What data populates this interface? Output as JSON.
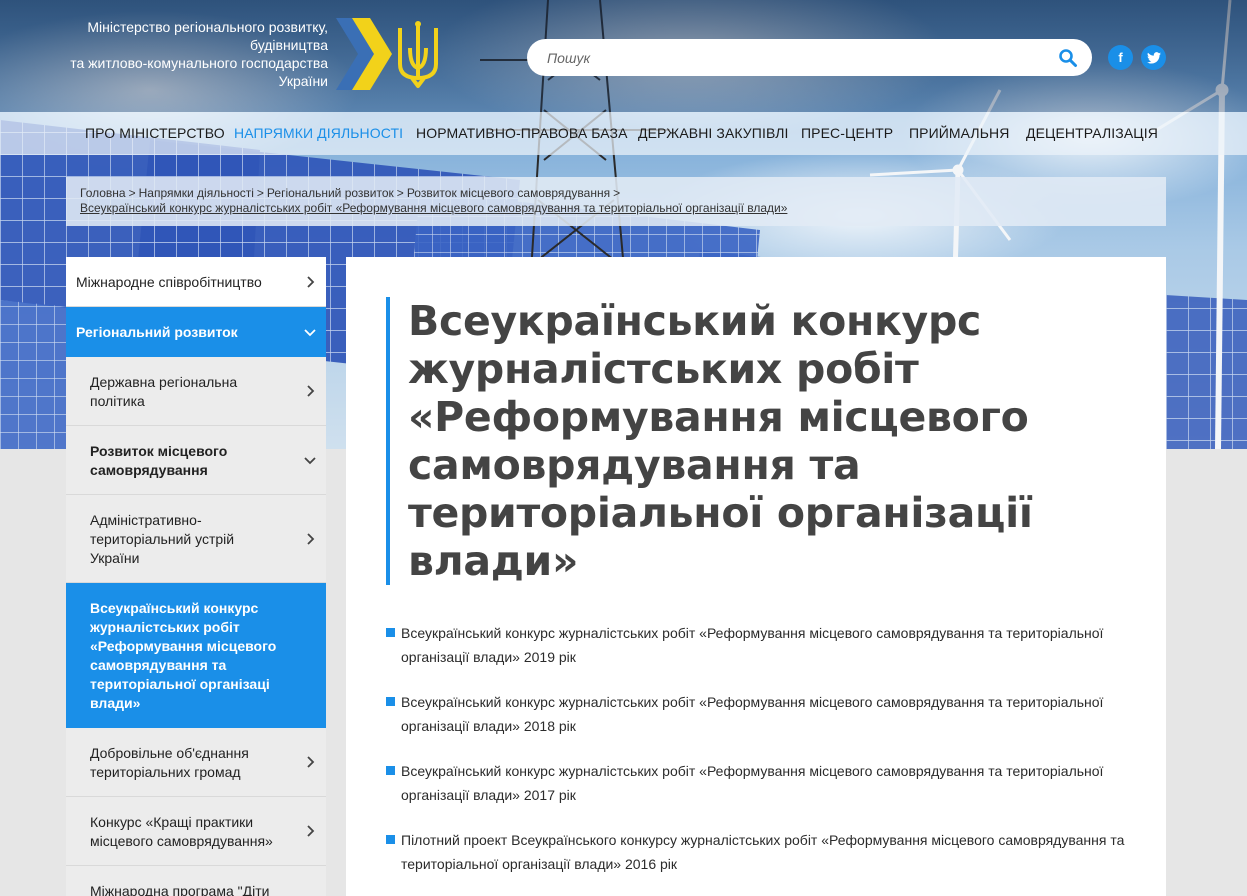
{
  "header": {
    "ministry_line1": "Міністерство регіонального розвитку,",
    "ministry_line2": "будівництва",
    "ministry_line3": "та житлово-комунального господарства",
    "ministry_line4": "України",
    "search_placeholder": "Пошук",
    "search_icon": "search-icon",
    "social_fb": "f",
    "social_tw": "twitter-icon"
  },
  "colors": {
    "accent": "#1a8fe8",
    "logo_blue": "#3a6fb5",
    "logo_yellow": "#f2d21a"
  },
  "nav": {
    "items": [
      "ПРО МІНІСТЕРСТВО",
      "НАПРЯМКИ ДІЯЛЬНОСТІ",
      "НОРМАТИВНО-ПРАВОВА БАЗА",
      "ДЕРЖАВНІ ЗАКУПІВЛІ",
      "ПРЕС-ЦЕНТР",
      "ПРИЙМАЛЬНЯ",
      "ДЕЦЕНТРАЛІЗАЦІЯ"
    ],
    "active": "НАПРЯМКИ ДІЯЛЬНОСТІ"
  },
  "breadcrumb": {
    "items": [
      "Головна",
      "Напрямки діяльності",
      "Регіональний розвиток",
      "Розвиток місцевого самоврядування"
    ],
    "separator": ">",
    "current": "Всеукраїнський конкурс журналістських робіт «Реформування місцевого самоврядування та територіальної організації влади»"
  },
  "sidebar": {
    "items": [
      {
        "label": "Міжнародне співробітництво",
        "chevron": "chevron-right-icon"
      },
      {
        "label": "Регіональний розвиток",
        "chevron": "chevron-down-icon"
      },
      {
        "label": "Державна регіональна політика",
        "chevron": "chevron-right-icon"
      },
      {
        "label": "Розвиток місцевого самоврядування",
        "chevron": "chevron-down-icon"
      },
      {
        "label": "Адміністративно-територіальний устрій України",
        "chevron": "chevron-right-icon"
      },
      {
        "label": "Всеукраїнський конкурс журналістських робіт «Реформування місцевого самоврядування та територіальної організаці влади»",
        "chevron": ""
      },
      {
        "label": "Добровільне об'єднання територіальних громад",
        "chevron": "chevron-right-icon"
      },
      {
        "label": "Конкурс «Кращі практики місцевого самоврядування»",
        "chevron": "chevron-right-icon"
      },
      {
        "label": "Міжнародна програма \"Діти",
        "chevron": ""
      }
    ]
  },
  "content": {
    "title": "Всеукраїнський конкурс журналістських робіт «Реформування місцевого самоврядування та територіальної організації влади»",
    "documents": [
      "Всеукраїнський конкурс журналістських робіт «Реформування місцевого самоврядування та територіальної організації влади» 2019 рік",
      "Всеукраїнський конкурс журналістських робіт «Реформування місцевого самоврядування та територіальної організації влади» 2018 рік",
      "Всеукраїнський конкурс журналістських робіт «Реформування місцевого самоврядування та територіальної організації влади» 2017 рік",
      "Пілотний проект Всеукраїнського конкурсу журналістських робіт «Реформування місцевого самоврядування та територіальної організації влади» 2016 рік"
    ]
  }
}
